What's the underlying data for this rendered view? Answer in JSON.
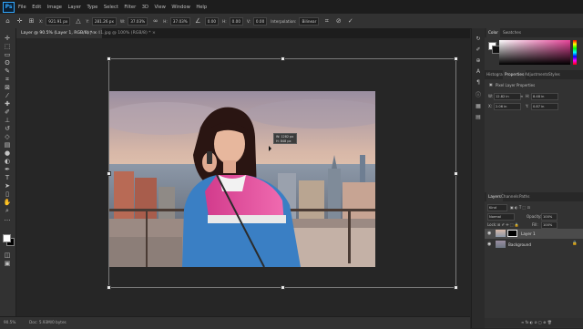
{
  "app": {
    "logo": "Ps",
    "menu": [
      "File",
      "Edit",
      "Image",
      "Layer",
      "Type",
      "Select",
      "Filter",
      "3D",
      "View",
      "Window",
      "Help"
    ]
  },
  "options_bar": {
    "x_value": "921.91 px",
    "y_value": "281.26 px",
    "w_value": "37.03%",
    "h_value": "37.03%",
    "angle_value": "0.00",
    "h_skew_value": "0.00",
    "v_skew_value": "0.00",
    "interpolation_label": "Interpolation:",
    "interpolation_value": "Bilinear"
  },
  "tabs": [
    {
      "label": "Layer @ 90.5% (Layer 1, RGB/8) *",
      "active": true
    },
    {
      "label": "Layer 41.jpg @ 100% (RGB/8) *",
      "active": false
    }
  ],
  "canvas": {
    "tooltip_line1": "W: 1282 px",
    "tooltip_line2": "H: 848 px"
  },
  "status": {
    "zoom": "90.5%",
    "doc_info": "Doc: 5.93M/0 bytes"
  },
  "color_panel": {
    "tabs": [
      "Color",
      "Swatches"
    ]
  },
  "properties_panel": {
    "tabs": [
      "Histogram",
      "Properties",
      "Adjustments",
      "Styles"
    ],
    "title": "Pixel Layer Properties",
    "w_label": "W:",
    "w_value": "12.82 in",
    "h_label": "H:",
    "h_value": "8.48 in",
    "x_label": "X:",
    "x_value": "2.06 in",
    "y_label": "Y:",
    "y_value": "0.87 in"
  },
  "layers_panel": {
    "tabs": [
      "Layers",
      "Channels",
      "Paths"
    ],
    "filter_label": "Kind",
    "blend_mode": "Normal",
    "opacity_label": "Opacity:",
    "opacity_value": "100%",
    "lock_label": "Lock:",
    "fill_label": "Fill:",
    "fill_value": "100%",
    "layers": [
      {
        "name": "Layer 1"
      },
      {
        "name": "Background"
      }
    ]
  },
  "colors": {
    "accent": "#31a8ff",
    "panel_bg": "#323232",
    "canvas_bg": "#262626",
    "jacket_pink": "#e8459a",
    "jacket_blue": "#3a7fc4"
  }
}
